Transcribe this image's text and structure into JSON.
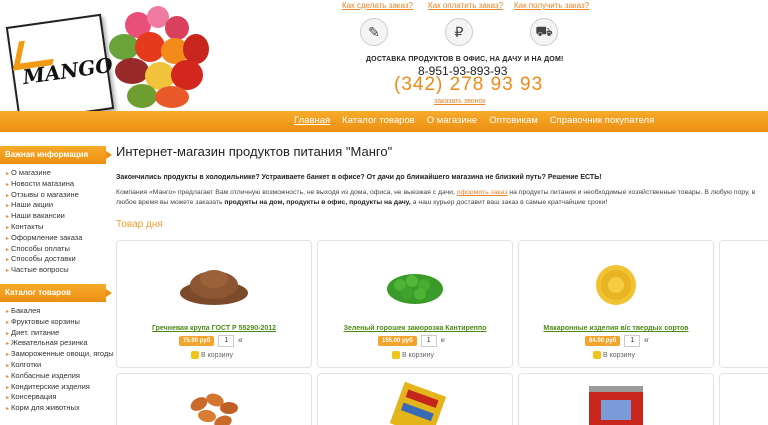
{
  "header": {
    "logo_text": "MANGO",
    "top_links": [
      "Как сделать заказ?",
      "Как оплатить заказ?",
      "Как получить заказ?"
    ],
    "delivery_slogan": "ДОСТАВКА ПРОДУКТОВ В ОФИС, НА ДАЧУ И НА ДОМ!",
    "phone_mobile": "8-951-93-893-93",
    "phone_main": "(342) 278 93 93",
    "callback_link": "заказать звонок"
  },
  "nav": {
    "items": [
      "Главная",
      "Каталог товаров",
      "О магазине",
      "Оптовикам",
      "Справочник покупателя"
    ]
  },
  "sidebar": {
    "info_title": "Важная информация",
    "info_items": [
      "О магазине",
      "Новости магазина",
      "Отзывы о магазине",
      "Наши акции",
      "Наши вакансии",
      "Контакты",
      "Оформление заказа",
      "Способы оплаты",
      "Способы доставки",
      "Частые вопросы"
    ],
    "catalog_title": "Каталог товаров",
    "catalog_items": [
      "Бакалея",
      "Фруктовые корзины",
      "Диет. питание",
      "Жевательная резинка",
      "Замороженные овощи, ягоды",
      "Колготки",
      "Колбасные изделия",
      "Кондитерские изделия",
      "Консервация",
      "Корм для животных"
    ]
  },
  "main": {
    "title": "Интернет-магазин продуктов питания \"Манго\"",
    "lead": "Закончились продукты в холодильнике? Устраиваете банкет в офисе? От дачи до ближайшего магазина не близкий путь? Решение ЕСТЬ!",
    "text_1": "Компания «Манго» предлагает Вам отличную возможность, не выходя из дома, офиса, не выезжая с дачи, ",
    "text_link": "оформить заказ",
    "text_2": " на продукты питания и необходимые хозяйственные товары. В любую пору, в любое время вы можете заказать ",
    "text_bold": "продукты на дом, продукты в офис, продукты на дачу,",
    "text_3": " а наш курьер доставит ваш заказ в самые кратчайшие сроки!",
    "day_title": "Товар дня"
  },
  "products": [
    {
      "name": "Гречневая крупа ГОСТ Р 55290-2012",
      "price": "75.00 руб",
      "qty": "1",
      "unit": "кг",
      "cart": "В корзину"
    },
    {
      "name": "Зеленый горошек заморозка Кантиреппо",
      "price": "155.00 руб",
      "qty": "1",
      "unit": "кг",
      "cart": "В корзину"
    },
    {
      "name": "Макаронные изделия в/с твердых сортов",
      "price": "64.00 руб",
      "qty": "1",
      "unit": "кг",
      "cart": "В корзину"
    }
  ],
  "colors": {
    "accent": "#f19a12",
    "link": "#e8842a",
    "product_link": "#4c8a18"
  },
  "icons": [
    "clipboard-icon",
    "ruble-icon",
    "delivery-truck-icon",
    "cart-icon"
  ]
}
